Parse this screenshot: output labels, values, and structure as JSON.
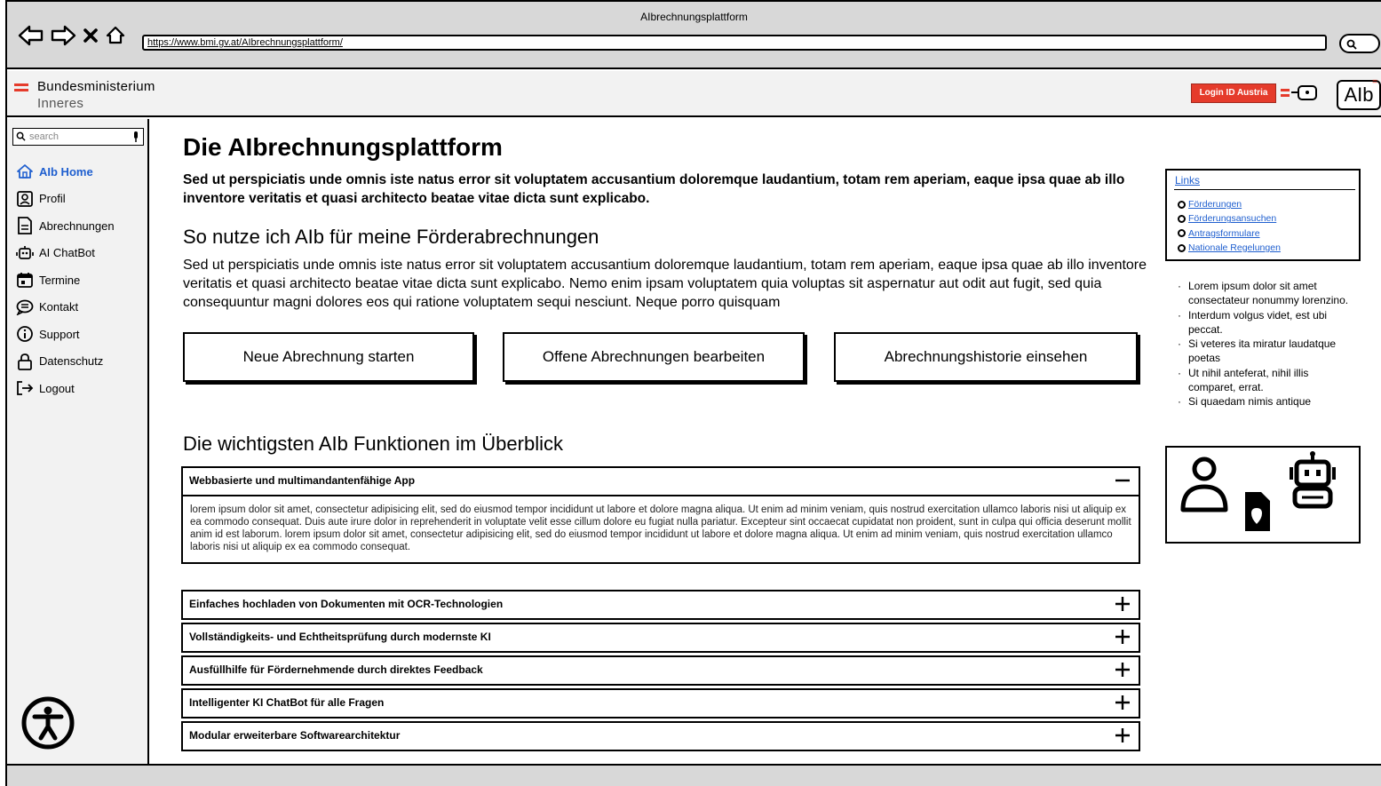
{
  "browser": {
    "window_title": "AIbrechnungsplattform",
    "url": "https://www.bmi.gv.at/AIbrechnungsplattform/"
  },
  "header": {
    "logo_line1": "Bundesministerium",
    "logo_line2": "Inneres",
    "login_label": "Login ID Austria",
    "brand_mark": "AIb",
    "brand_color": "#e53b2b"
  },
  "sidebar": {
    "search_placeholder": "search",
    "items": [
      {
        "label": "AIb Home",
        "icon": "home-icon",
        "active": true
      },
      {
        "label": "Profil",
        "icon": "profile-icon"
      },
      {
        "label": "Abrechnungen",
        "icon": "document-icon"
      },
      {
        "label": "AI ChatBot",
        "icon": "robot-icon"
      },
      {
        "label": "Termine",
        "icon": "calendar-icon"
      },
      {
        "label": "Kontakt",
        "icon": "chat-icon"
      },
      {
        "label": "Support",
        "icon": "info-icon"
      },
      {
        "label": "Datenschutz",
        "icon": "lock-icon"
      },
      {
        "label": "Logout",
        "icon": "logout-icon"
      }
    ],
    "active_color": "#1f5fcf"
  },
  "main": {
    "title": "Die AIbrechnungsplattform",
    "lead": "Sed ut perspiciatis unde omnis iste natus error sit voluptatem accusantium doloremque laudantium, totam rem aperiam, eaque ipsa quae ab illo inventore veritatis et quasi architecto beatae vitae dicta sunt explicabo.",
    "section1_title": "So nutze ich AIb für meine Förderabrechnungen",
    "section1_text": "Sed ut perspiciatis unde omnis iste natus error sit voluptatem accusantium doloremque laudantium, totam rem aperiam, eaque ipsa quae ab illo inventore veritatis et quasi architecto beatae vitae dicta sunt explicabo. Nemo enim ipsam voluptatem quia voluptas sit aspernatur aut odit aut fugit, sed quia consequuntur magni dolores eos qui ratione voluptatem sequi nesciunt. Neque porro quisquam",
    "buttons": [
      "Neue Abrechnung starten",
      "Offene Abrechnungen bearbeiten",
      "Abrechnungshistorie einsehen"
    ],
    "section2_title": "Die wichtigsten AIb Funktionen im Überblick",
    "accordion": [
      {
        "title": "Webbasierte und multimandantenfähige App",
        "expanded": true,
        "body": "lorem ipsum dolor sit amet, consectetur adipisicing elit, sed do eiusmod tempor incididunt ut labore et dolore magna aliqua. Ut enim ad minim veniam, quis nostrud exercitation ullamco laboris nisi ut aliquip ex ea commodo consequat. Duis aute irure dolor in reprehenderit in voluptate velit esse cillum dolore eu fugiat nulla pariatur. Excepteur sint occaecat cupidatat non proident, sunt in culpa qui officia deserunt mollit anim id est laborum. lorem ipsum dolor sit amet, consectetur adipisicing elit, sed do eiusmod tempor incididunt ut labore et dolore magna aliqua. Ut enim ad minim veniam, quis nostrud exercitation ullamco laboris nisi ut aliquip ex ea commodo consequat."
      },
      {
        "title": "Einfaches hochladen von Dokumenten mit OCR-Technologien",
        "expanded": false
      },
      {
        "title": "Vollständigkeits- und Echtheitsprüfung durch modernste KI",
        "expanded": false
      },
      {
        "title": "Ausfüllhilfe für Fördernehmende durch direktes Feedback",
        "expanded": false
      },
      {
        "title": "Intelligenter KI ChatBot für alle Fragen",
        "expanded": false
      },
      {
        "title": "Modular erweiterbare Softwarearchitektur",
        "expanded": false
      }
    ]
  },
  "right": {
    "links_title": "Links",
    "links": [
      "Förderungen",
      "Förderungsansuchen",
      "Antragsformulare",
      "Nationale Regelungen"
    ],
    "bullets": [
      "Lorem ipsum dolor sit amet consectateur nonummy lorenzino.",
      "Interdum volgus videt, est ubi peccat.",
      "Si veteres ita miratur laudatque poetas",
      "Ut nihil anteferat, nihil illis comparet, errat.",
      "Si quaedam nimis antique"
    ],
    "illustration_icons": [
      "user-icon",
      "document-heart-icon",
      "robot-icon"
    ]
  }
}
